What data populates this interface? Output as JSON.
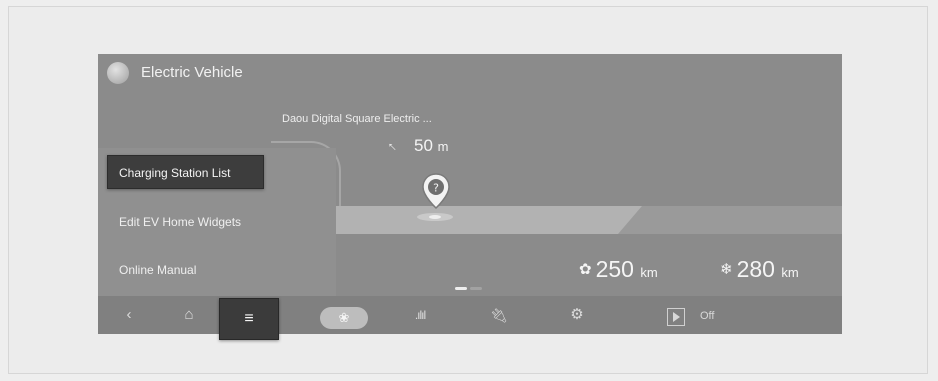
{
  "header": {
    "title": "Electric Vehicle",
    "icon": "globe-icon"
  },
  "map": {
    "station_name": "Daou Digital Square Electric ...",
    "distance_value": "50",
    "distance_unit": "m",
    "pin_icon": "charging-station-pin-icon"
  },
  "menu": {
    "items": [
      {
        "label": "Charging Station List",
        "active": true
      },
      {
        "label": "Edit EV Home Widgets",
        "active": false
      },
      {
        "label": "Online Manual",
        "active": false
      }
    ]
  },
  "ranges": [
    {
      "icon": "fan-icon",
      "value": "250",
      "unit": "km"
    },
    {
      "icon": "fan-off-icon",
      "value": "280",
      "unit": "km"
    }
  ],
  "page_indicator": {
    "count": 2,
    "active": 0
  },
  "bottom_bar": {
    "back_icon": "chevron-left-icon",
    "home_icon": "home-icon",
    "menu_icon": "menu-icon",
    "eco_icon": "leaf-icon",
    "stats_icon": "bar-chart-icon",
    "charge_icon": "charging-plug-icon",
    "settings_icon": "gear-icon",
    "play_icon": "play-icon",
    "off_label": "Off"
  },
  "colors": {
    "screen_bg": "#8b8b8b",
    "active_bg": "#3b3b3b",
    "text": "#f1f1f1"
  }
}
